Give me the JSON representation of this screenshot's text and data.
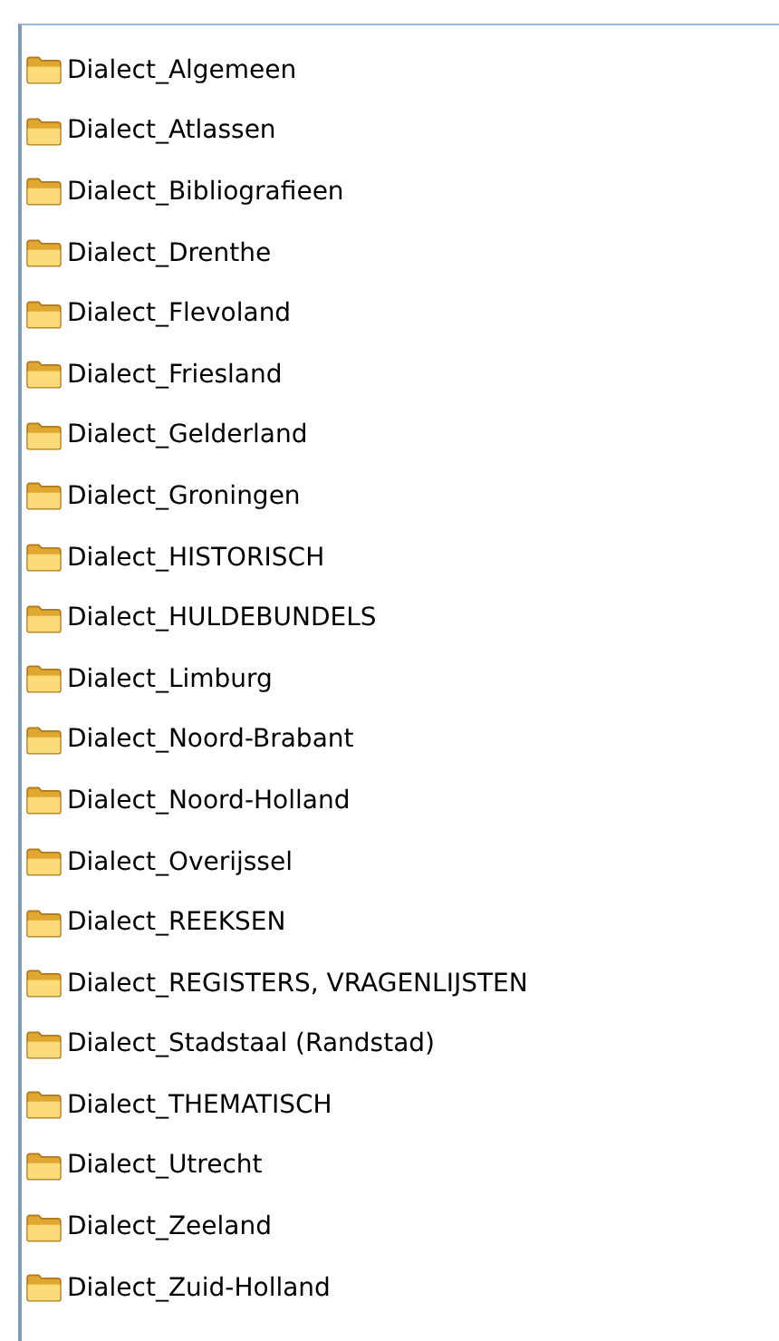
{
  "folders": [
    {
      "name": "Dialect_Algemeen"
    },
    {
      "name": "Dialect_Atlassen"
    },
    {
      "name": "Dialect_Bibliografieen"
    },
    {
      "name": "Dialect_Drenthe"
    },
    {
      "name": "Dialect_Flevoland"
    },
    {
      "name": "Dialect_Friesland"
    },
    {
      "name": "Dialect_Gelderland"
    },
    {
      "name": "Dialect_Groningen"
    },
    {
      "name": "Dialect_HISTORISCH"
    },
    {
      "name": "Dialect_HULDEBUNDELS"
    },
    {
      "name": "Dialect_Limburg"
    },
    {
      "name": "Dialect_Noord-Brabant"
    },
    {
      "name": "Dialect_Noord-Holland"
    },
    {
      "name": "Dialect_Overijssel"
    },
    {
      "name": "Dialect_REEKSEN"
    },
    {
      "name": "Dialect_REGISTERS, VRAGENLIJSTEN"
    },
    {
      "name": "Dialect_Stadstaal (Randstad)"
    },
    {
      "name": "Dialect_THEMATISCH"
    },
    {
      "name": "Dialect_Utrecht"
    },
    {
      "name": "Dialect_Zeeland"
    },
    {
      "name": "Dialect_Zuid-Holland"
    }
  ]
}
